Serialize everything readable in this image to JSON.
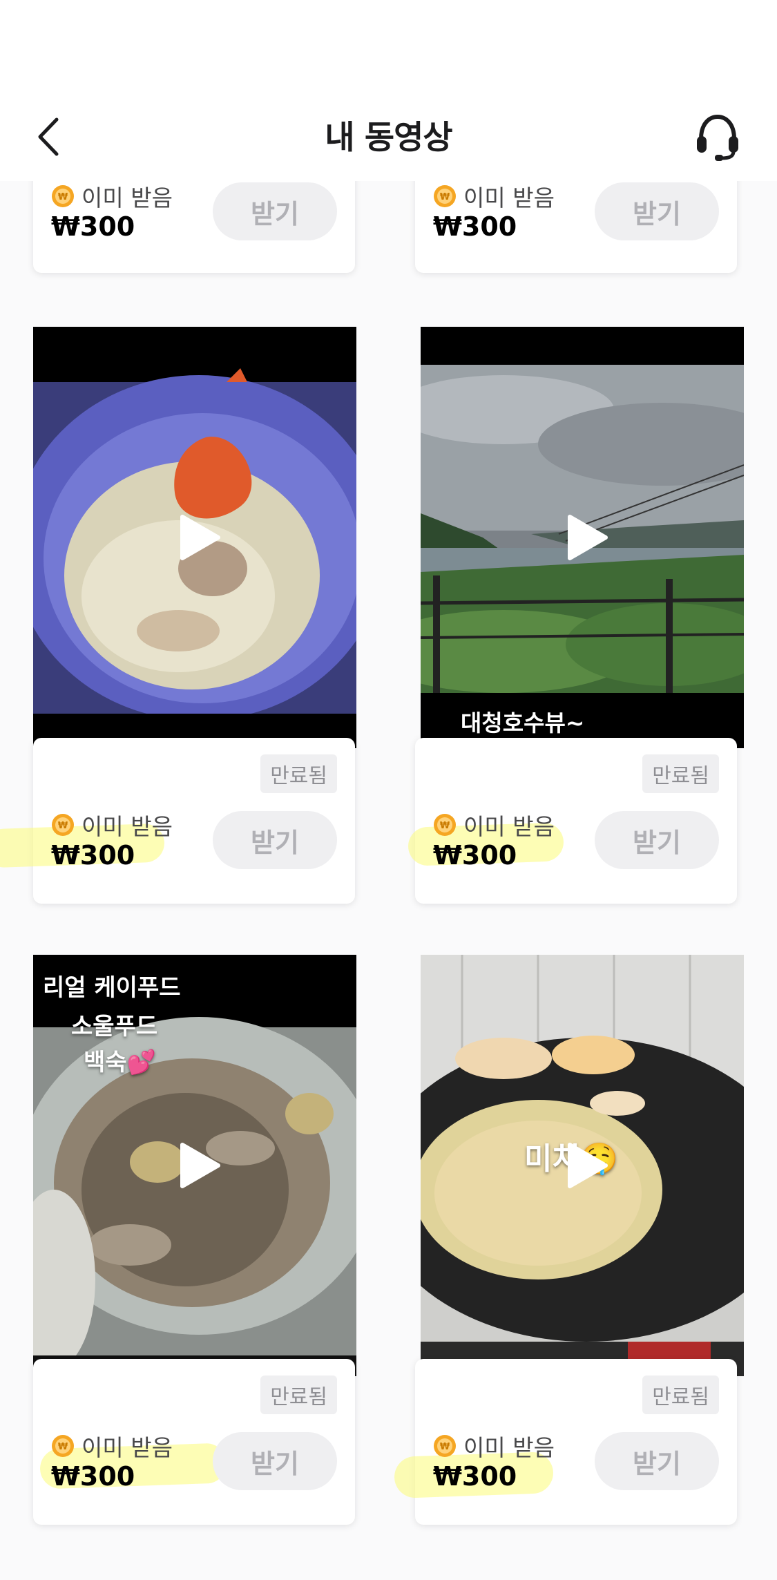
{
  "header": {
    "title": "내 동영상"
  },
  "labels": {
    "received": "이미 받음",
    "amount": "₩300",
    "receive_button": "받기",
    "expired": "만료됨"
  },
  "cards": [
    {
      "id": 1,
      "expired": false,
      "overlay": []
    },
    {
      "id": 2,
      "expired": false,
      "overlay": []
    },
    {
      "id": 3,
      "expired": true,
      "overlay": []
    },
    {
      "id": 4,
      "expired": true,
      "overlay": [
        "대청호수뷰~"
      ]
    },
    {
      "id": 5,
      "expired": true,
      "overlay": [
        "리얼 케이푸드",
        "소울푸드",
        "백숙💕"
      ]
    },
    {
      "id": 6,
      "expired": true,
      "overlay": [
        "미쳐🤤"
      ]
    }
  ],
  "colors": {
    "accent_highlight": "#fcfc78",
    "coin": "#f5a623",
    "button_bg": "#efeff1"
  }
}
